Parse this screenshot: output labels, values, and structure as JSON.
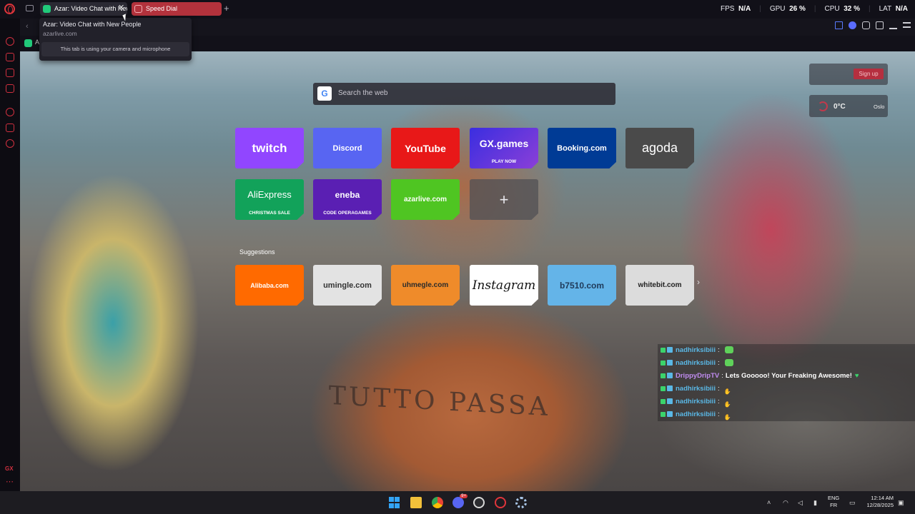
{
  "tabs": [
    {
      "label": "Azar: Video Chat with New People",
      "favicon": "azar-icon"
    },
    {
      "label": "Speed Dial",
      "favicon": "speed-dial-icon"
    }
  ],
  "stats": {
    "fps_label": "FPS",
    "fps_value": "N/A",
    "gpu_label": "GPU",
    "gpu_value": "26 %",
    "cpu_label": "CPU",
    "cpu_value": "32 %",
    "lat_label": "LAT",
    "lat_value": "N/A"
  },
  "tooltip": {
    "title": "Azar: Video Chat with New People",
    "url": "azarlive.com",
    "note": "This tab is using your camera and microphone"
  },
  "bookmark": {
    "label": "A"
  },
  "search": {
    "placeholder": "Search the web",
    "engine_badge": "G"
  },
  "speed_dial": [
    {
      "label": "twitch",
      "color": "#9146ff"
    },
    {
      "label": "Discord",
      "color": "#5865f2"
    },
    {
      "label": "YouTube",
      "color": "#ff0000"
    },
    {
      "label": "GX.games",
      "sub": "PLAY NOW",
      "color": "#6b3ff0"
    },
    {
      "label": "Booking.com",
      "color": "#003b95"
    },
    {
      "label": "agoda",
      "color": "#4a4a4a"
    },
    {
      "label": "AliExpress",
      "sub": "CHRISTMAS SALE",
      "color": "#12a25a"
    },
    {
      "label": "eneba",
      "sub": "CODE OPERAGAMES",
      "color": "#5a1fb3"
    },
    {
      "label": "azarlive.com",
      "color": "#4fc522"
    },
    {
      "label": "+",
      "color": "#5a5a5a"
    }
  ],
  "suggestions_label": "Suggestions",
  "suggestions": [
    {
      "label": "Alibaba.com",
      "color": "#ff6a00"
    },
    {
      "label": "umingle.com",
      "color": "#dcdcdc"
    },
    {
      "label": "uhmegle.com",
      "color": "#ef8b2a"
    },
    {
      "label": "Instagram",
      "color": "#ffffff"
    },
    {
      "label": "b7510.com",
      "color": "#64b4e8"
    },
    {
      "label": "whitebit.com",
      "color": "#d8d8d8"
    }
  ],
  "widgets": {
    "signup_label": "Sign up",
    "weather_temp": "0°C",
    "weather_city": "Oslo"
  },
  "chat": [
    {
      "user": "nadhirksibiii",
      "sep": ":",
      "message": "",
      "user_color": "#5ab8e6",
      "emote": "frog"
    },
    {
      "user": "nadhirksibiii",
      "sep": ":",
      "message": "",
      "user_color": "#5ab8e6",
      "emote": "frog"
    },
    {
      "user": "DrippyDripTV",
      "sep": ":",
      "message": "Lets Gooooo! Your Freaking Awesome!",
      "user_color": "#c08cf0",
      "emote": "heart"
    },
    {
      "user": "nadhirksibiii",
      "sep": ":",
      "message": "",
      "user_color": "#5ab8e6",
      "emote": "hands"
    },
    {
      "user": "nadhirksibiii",
      "sep": ":",
      "message": "",
      "user_color": "#5ab8e6",
      "emote": "hands"
    },
    {
      "user": "nadhirksibiii",
      "sep": ":",
      "message": "",
      "user_color": "#5ab8e6",
      "emote": "hands"
    }
  ],
  "tattoo_text": "TUTTO PASSA",
  "sidebar_gx": "GX",
  "taskbar": {
    "lang_top": "ENG",
    "lang_bottom": "FR",
    "time": "12:14 AM",
    "date": "12/28/2025",
    "discord_badge": "9+"
  }
}
